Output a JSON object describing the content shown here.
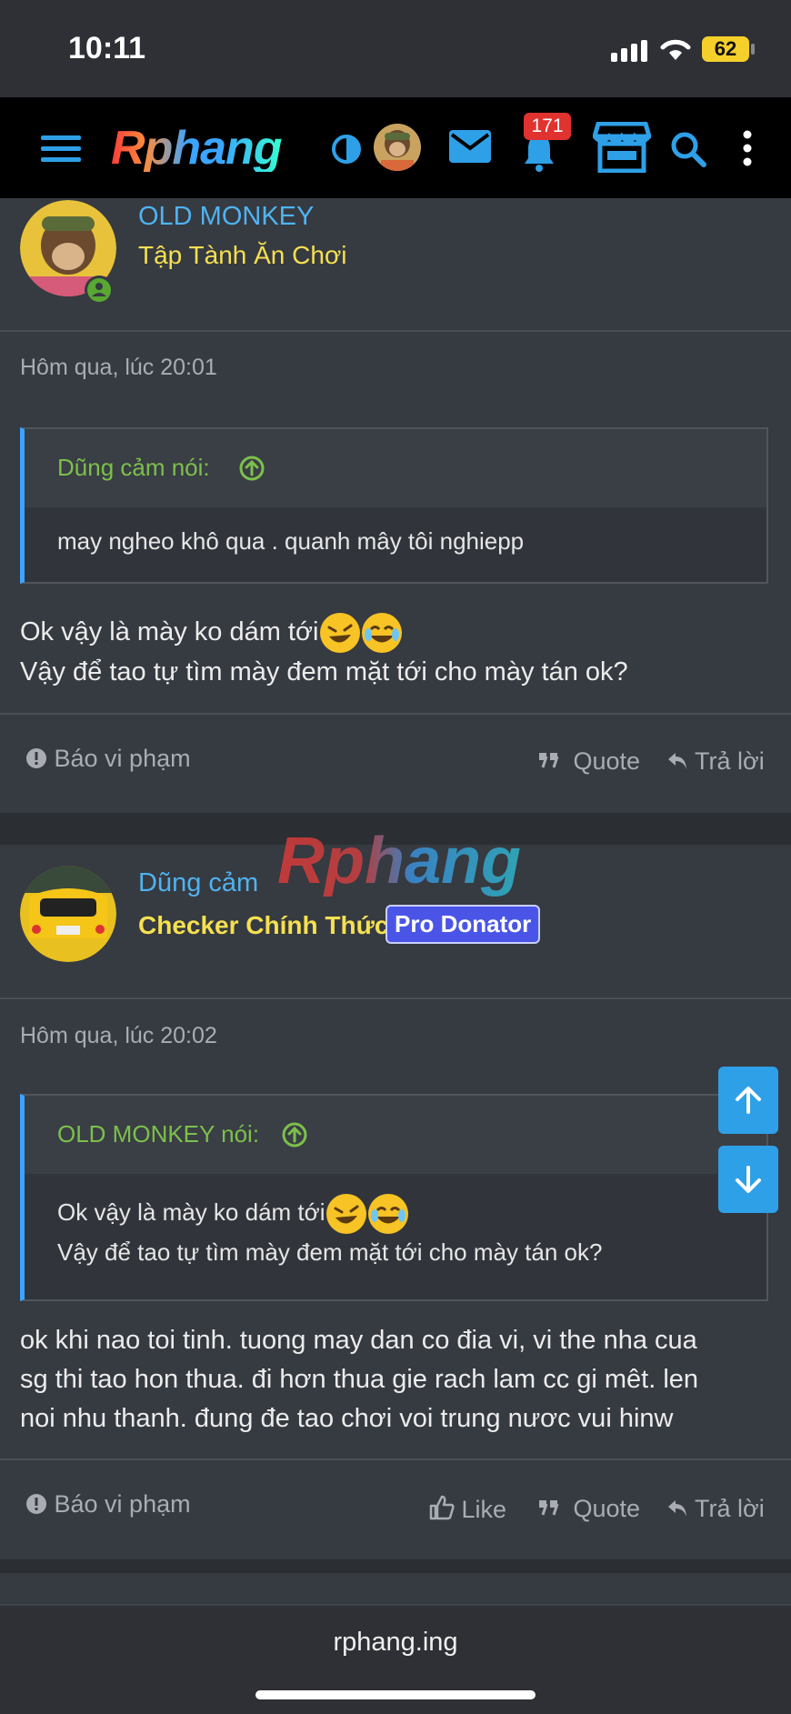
{
  "status_bar": {
    "time": "10:11",
    "battery": "62"
  },
  "nav": {
    "logo": "Rphang",
    "notification_count": "171"
  },
  "posts": [
    {
      "username": "OLD MONKEY",
      "user_title": "Tập Tành Ăn Chơi",
      "timestamp": "Hôm qua, lúc 20:01",
      "quote_author": "Dũng cảm nói:",
      "quote_text": "may ngheo khô qua . quanh mây tôi nghiepp",
      "message_line1": "Ok vậy là mày ko dám tới",
      "message_line2": "Vậy để tao tự tìm mày đem mặt tới cho mày tán ok?",
      "report_label": "Báo vi phạm",
      "quote_label": "Quote",
      "reply_label": "Trả lời"
    },
    {
      "username": "Dũng cảm",
      "user_title": "Checker Chính Thức",
      "badge": "Pro Donator",
      "timestamp": "Hôm qua, lúc 20:02",
      "quote_author": "OLD MONKEY nói:",
      "quote_line1": "Ok vậy là mày ko dám tới",
      "quote_line2": "Vậy để tao tự tìm mày đem mặt tới cho mày tán ok?",
      "message_line1": "ok khi nao toi tinh. tuong may dan co đia vi, vi the nha cua",
      "message_line2": "sg thi tao hon thua. đi hơn thua gie rach lam cc gi mêt. len",
      "message_line3": "noi nhu thanh. đung đe tao chơi voi trung nươc vui hinw",
      "report_label": "Báo vi phạm",
      "like_label": "Like",
      "quote_label": "Quote",
      "reply_label": "Trả lời"
    }
  ],
  "watermark": "Rphang",
  "browser": {
    "url": "rphang.ing"
  },
  "colors": {
    "accent": "#4fb3f0",
    "title_yellow": "#f5e050",
    "quote_green": "#7cc04a",
    "scroll_button": "#2ea0e8"
  }
}
